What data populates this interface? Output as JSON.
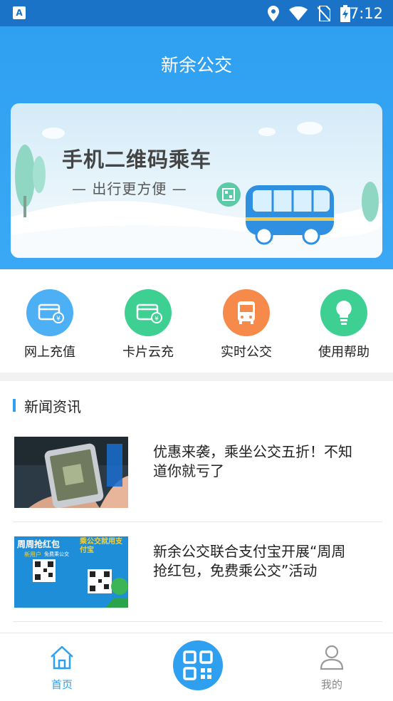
{
  "status_bar": {
    "time": "7:12",
    "app_icon_letter": "A"
  },
  "header": {
    "title": "新余公交"
  },
  "banner": {
    "headline": "手机二维码乘车",
    "subline": "— 出行更方便 —"
  },
  "quick_actions": [
    {
      "label": "网上充值",
      "icon": "card-recharge-icon",
      "color": "#4db0f5"
    },
    {
      "label": "卡片云充",
      "icon": "card-cloud-recharge-icon",
      "color": "#3ecf93"
    },
    {
      "label": "实时公交",
      "icon": "bus-icon",
      "color": "#f58a4b"
    },
    {
      "label": "使用帮助",
      "icon": "lightbulb-icon",
      "color": "#3ecf93"
    }
  ],
  "news": {
    "section_title": "新闻资讯",
    "items": [
      {
        "title": "优惠来袭，乘坐公交五折！不知道你就亏了",
        "thumb": "phone-payment-photo"
      },
      {
        "title": "新余公交联合支付宝开展“周周抢红包，免费乘公交”活动",
        "thumb": "alipay-promo-poster",
        "poster_text": {
          "left_title": "周周抢红包",
          "left_badge": "新用户",
          "left_sub": "免费乘公交",
          "right_title": "乘公交就用支付宝"
        }
      }
    ]
  },
  "tabs": [
    {
      "label": "首页",
      "icon": "home-icon",
      "active": true
    },
    {
      "label": "我的",
      "icon": "user-icon",
      "active": false
    }
  ],
  "colors": {
    "primary": "#2f9ff0",
    "status_bar": "#1b73c8",
    "tab_active": "#2f9ff0",
    "tab_inactive": "#888888"
  }
}
